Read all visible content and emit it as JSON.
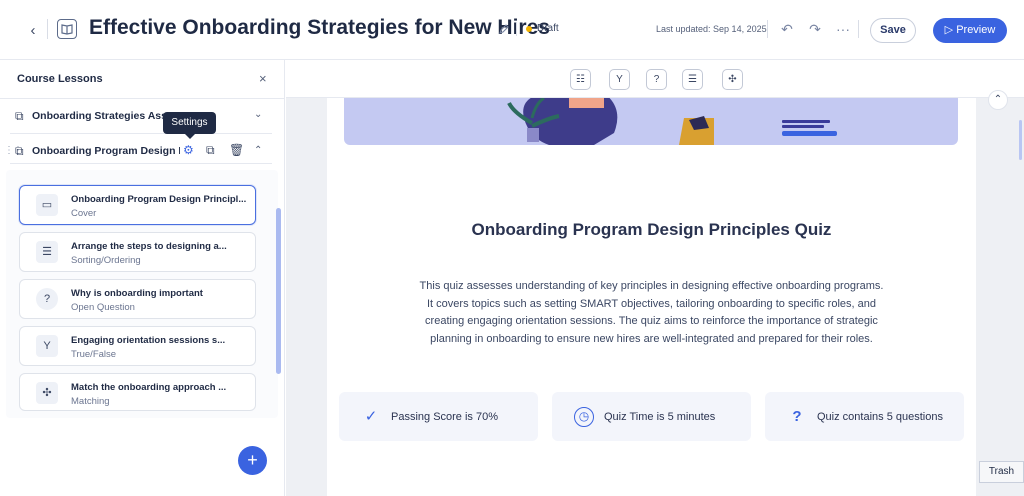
{
  "header": {
    "title": "Effective Onboarding Strategies for New Hires",
    "status": "Draft",
    "last_updated": "Last updated: Sep 14, 2025",
    "save_label": "Save",
    "preview_label": "Preview",
    "icons": {
      "back": "chevron-left-icon",
      "book": "book-icon",
      "edit": "pencil-icon",
      "undo": "undo-icon",
      "redo": "redo-icon",
      "more": "more-icon"
    }
  },
  "sidebar": {
    "title": "Course Lessons",
    "lessons": [
      {
        "label": "Onboarding Strategies Assess",
        "expanded": false
      },
      {
        "label": "Onboarding Program Design Pr...",
        "expanded": true
      }
    ],
    "tooltip": "Settings",
    "cards": [
      {
        "title": "Onboarding Program Design Principl...",
        "type": "Cover",
        "icon": "slide-icon",
        "glyph": "▭"
      },
      {
        "title": "Arrange the steps to designing a...",
        "type": "Sorting/Ordering",
        "icon": "ordered-list-icon",
        "glyph": "☰"
      },
      {
        "title": "Why is onboarding important",
        "type": "Open Question",
        "icon": "question-icon",
        "glyph": "?"
      },
      {
        "title": "Engaging orientation sessions s...",
        "type": "True/False",
        "icon": "branch-icon",
        "glyph": "Y"
      },
      {
        "title": "Match the onboarding approach ...",
        "type": "Matching",
        "icon": "puzzle-icon",
        "glyph": "✣"
      }
    ]
  },
  "canvas": {
    "quiz_title": "Onboarding Program Design Principles Quiz",
    "quiz_description": "This quiz assesses understanding of key principles in designing effective onboarding programs. It covers topics such as setting SMART objectives, tailoring onboarding to specific roles, and creating engaging orientation sessions. The quiz aims to reinforce the importance of strategic planning in onboarding to ensure new hires are well-integrated and prepared for their roles.",
    "info": [
      {
        "text": "Passing Score is 70%",
        "icon": "check-icon",
        "glyph": "✓"
      },
      {
        "text": "Quiz Time is 5 minutes",
        "icon": "clock-icon",
        "glyph": "◷"
      },
      {
        "text": "Quiz contains 5 questions",
        "icon": "question-mark-icon",
        "glyph": "?"
      }
    ]
  },
  "trash_tooltip": "Trash",
  "colors": {
    "accent": "#3a63e0",
    "draft": "#f2b200",
    "hero": "#c4c9f2"
  }
}
